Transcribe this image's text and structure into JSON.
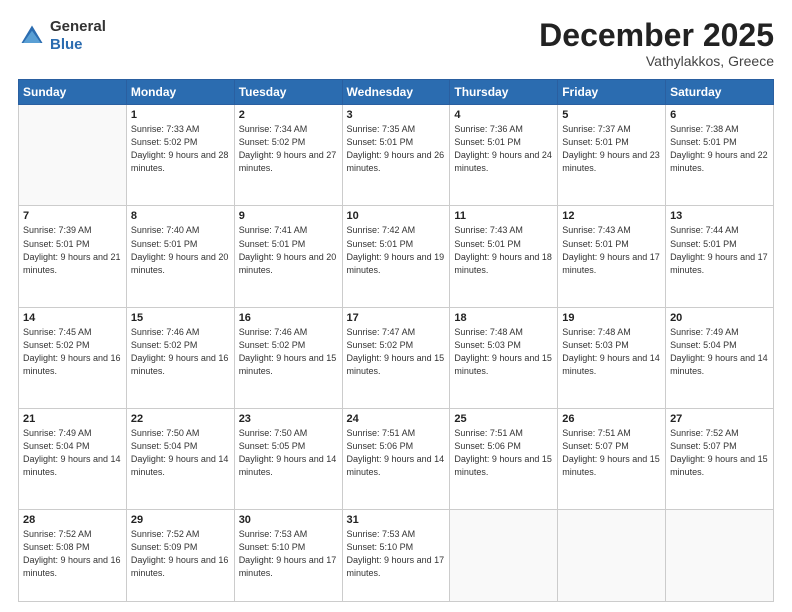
{
  "header": {
    "logo_general": "General",
    "logo_blue": "Blue",
    "month_title": "December 2025",
    "location": "Vathylakkos, Greece"
  },
  "weekdays": [
    "Sunday",
    "Monday",
    "Tuesday",
    "Wednesday",
    "Thursday",
    "Friday",
    "Saturday"
  ],
  "rows": [
    [
      {
        "day": "",
        "sunrise": "",
        "sunset": "",
        "daylight": ""
      },
      {
        "day": "1",
        "sunrise": "Sunrise: 7:33 AM",
        "sunset": "Sunset: 5:02 PM",
        "daylight": "Daylight: 9 hours and 28 minutes."
      },
      {
        "day": "2",
        "sunrise": "Sunrise: 7:34 AM",
        "sunset": "Sunset: 5:02 PM",
        "daylight": "Daylight: 9 hours and 27 minutes."
      },
      {
        "day": "3",
        "sunrise": "Sunrise: 7:35 AM",
        "sunset": "Sunset: 5:01 PM",
        "daylight": "Daylight: 9 hours and 26 minutes."
      },
      {
        "day": "4",
        "sunrise": "Sunrise: 7:36 AM",
        "sunset": "Sunset: 5:01 PM",
        "daylight": "Daylight: 9 hours and 24 minutes."
      },
      {
        "day": "5",
        "sunrise": "Sunrise: 7:37 AM",
        "sunset": "Sunset: 5:01 PM",
        "daylight": "Daylight: 9 hours and 23 minutes."
      },
      {
        "day": "6",
        "sunrise": "Sunrise: 7:38 AM",
        "sunset": "Sunset: 5:01 PM",
        "daylight": "Daylight: 9 hours and 22 minutes."
      }
    ],
    [
      {
        "day": "7",
        "sunrise": "Sunrise: 7:39 AM",
        "sunset": "Sunset: 5:01 PM",
        "daylight": "Daylight: 9 hours and 21 minutes."
      },
      {
        "day": "8",
        "sunrise": "Sunrise: 7:40 AM",
        "sunset": "Sunset: 5:01 PM",
        "daylight": "Daylight: 9 hours and 20 minutes."
      },
      {
        "day": "9",
        "sunrise": "Sunrise: 7:41 AM",
        "sunset": "Sunset: 5:01 PM",
        "daylight": "Daylight: 9 hours and 20 minutes."
      },
      {
        "day": "10",
        "sunrise": "Sunrise: 7:42 AM",
        "sunset": "Sunset: 5:01 PM",
        "daylight": "Daylight: 9 hours and 19 minutes."
      },
      {
        "day": "11",
        "sunrise": "Sunrise: 7:43 AM",
        "sunset": "Sunset: 5:01 PM",
        "daylight": "Daylight: 9 hours and 18 minutes."
      },
      {
        "day": "12",
        "sunrise": "Sunrise: 7:43 AM",
        "sunset": "Sunset: 5:01 PM",
        "daylight": "Daylight: 9 hours and 17 minutes."
      },
      {
        "day": "13",
        "sunrise": "Sunrise: 7:44 AM",
        "sunset": "Sunset: 5:01 PM",
        "daylight": "Daylight: 9 hours and 17 minutes."
      }
    ],
    [
      {
        "day": "14",
        "sunrise": "Sunrise: 7:45 AM",
        "sunset": "Sunset: 5:02 PM",
        "daylight": "Daylight: 9 hours and 16 minutes."
      },
      {
        "day": "15",
        "sunrise": "Sunrise: 7:46 AM",
        "sunset": "Sunset: 5:02 PM",
        "daylight": "Daylight: 9 hours and 16 minutes."
      },
      {
        "day": "16",
        "sunrise": "Sunrise: 7:46 AM",
        "sunset": "Sunset: 5:02 PM",
        "daylight": "Daylight: 9 hours and 15 minutes."
      },
      {
        "day": "17",
        "sunrise": "Sunrise: 7:47 AM",
        "sunset": "Sunset: 5:02 PM",
        "daylight": "Daylight: 9 hours and 15 minutes."
      },
      {
        "day": "18",
        "sunrise": "Sunrise: 7:48 AM",
        "sunset": "Sunset: 5:03 PM",
        "daylight": "Daylight: 9 hours and 15 minutes."
      },
      {
        "day": "19",
        "sunrise": "Sunrise: 7:48 AM",
        "sunset": "Sunset: 5:03 PM",
        "daylight": "Daylight: 9 hours and 14 minutes."
      },
      {
        "day": "20",
        "sunrise": "Sunrise: 7:49 AM",
        "sunset": "Sunset: 5:04 PM",
        "daylight": "Daylight: 9 hours and 14 minutes."
      }
    ],
    [
      {
        "day": "21",
        "sunrise": "Sunrise: 7:49 AM",
        "sunset": "Sunset: 5:04 PM",
        "daylight": "Daylight: 9 hours and 14 minutes."
      },
      {
        "day": "22",
        "sunrise": "Sunrise: 7:50 AM",
        "sunset": "Sunset: 5:04 PM",
        "daylight": "Daylight: 9 hours and 14 minutes."
      },
      {
        "day": "23",
        "sunrise": "Sunrise: 7:50 AM",
        "sunset": "Sunset: 5:05 PM",
        "daylight": "Daylight: 9 hours and 14 minutes."
      },
      {
        "day": "24",
        "sunrise": "Sunrise: 7:51 AM",
        "sunset": "Sunset: 5:06 PM",
        "daylight": "Daylight: 9 hours and 14 minutes."
      },
      {
        "day": "25",
        "sunrise": "Sunrise: 7:51 AM",
        "sunset": "Sunset: 5:06 PM",
        "daylight": "Daylight: 9 hours and 15 minutes."
      },
      {
        "day": "26",
        "sunrise": "Sunrise: 7:51 AM",
        "sunset": "Sunset: 5:07 PM",
        "daylight": "Daylight: 9 hours and 15 minutes."
      },
      {
        "day": "27",
        "sunrise": "Sunrise: 7:52 AM",
        "sunset": "Sunset: 5:07 PM",
        "daylight": "Daylight: 9 hours and 15 minutes."
      }
    ],
    [
      {
        "day": "28",
        "sunrise": "Sunrise: 7:52 AM",
        "sunset": "Sunset: 5:08 PM",
        "daylight": "Daylight: 9 hours and 16 minutes."
      },
      {
        "day": "29",
        "sunrise": "Sunrise: 7:52 AM",
        "sunset": "Sunset: 5:09 PM",
        "daylight": "Daylight: 9 hours and 16 minutes."
      },
      {
        "day": "30",
        "sunrise": "Sunrise: 7:53 AM",
        "sunset": "Sunset: 5:10 PM",
        "daylight": "Daylight: 9 hours and 17 minutes."
      },
      {
        "day": "31",
        "sunrise": "Sunrise: 7:53 AM",
        "sunset": "Sunset: 5:10 PM",
        "daylight": "Daylight: 9 hours and 17 minutes."
      },
      {
        "day": "",
        "sunrise": "",
        "sunset": "",
        "daylight": ""
      },
      {
        "day": "",
        "sunrise": "",
        "sunset": "",
        "daylight": ""
      },
      {
        "day": "",
        "sunrise": "",
        "sunset": "",
        "daylight": ""
      }
    ]
  ]
}
